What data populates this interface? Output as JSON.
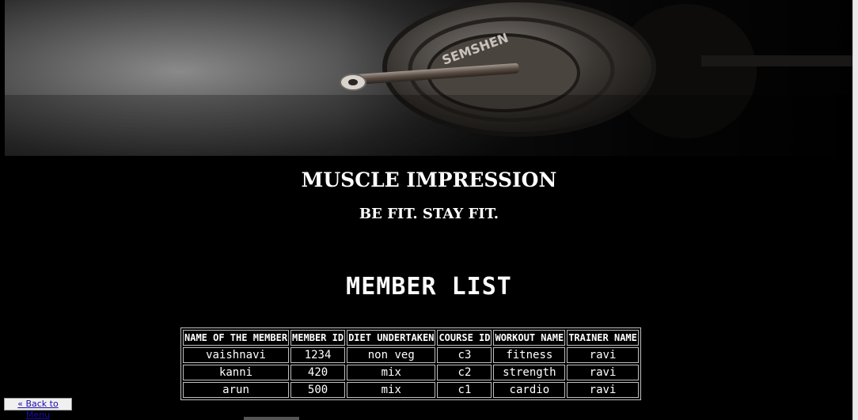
{
  "brand": {
    "title": "MUSCLE IMPRESSION",
    "tagline": "BE FIT. STAY FIT."
  },
  "banner": {
    "plate_text": "SEMSHEN"
  },
  "heading": "MEMBER LIST",
  "table": {
    "columns": [
      "NAME OF THE MEMBER",
      "MEMBER ID",
      "DIET UNDERTAKEN",
      "COURSE ID",
      "WORKOUT NAME",
      "TRAINER NAME"
    ],
    "rows": [
      [
        "vaishnavi",
        "1234",
        "non veg",
        "c3",
        "fitness",
        "ravi"
      ],
      [
        "kanni",
        "420",
        "mix",
        "c2",
        "strength",
        "ravi"
      ],
      [
        "arun",
        "500",
        "mix",
        "c1",
        "cardio",
        "ravi"
      ]
    ]
  },
  "back_link": "« Back to Menu"
}
